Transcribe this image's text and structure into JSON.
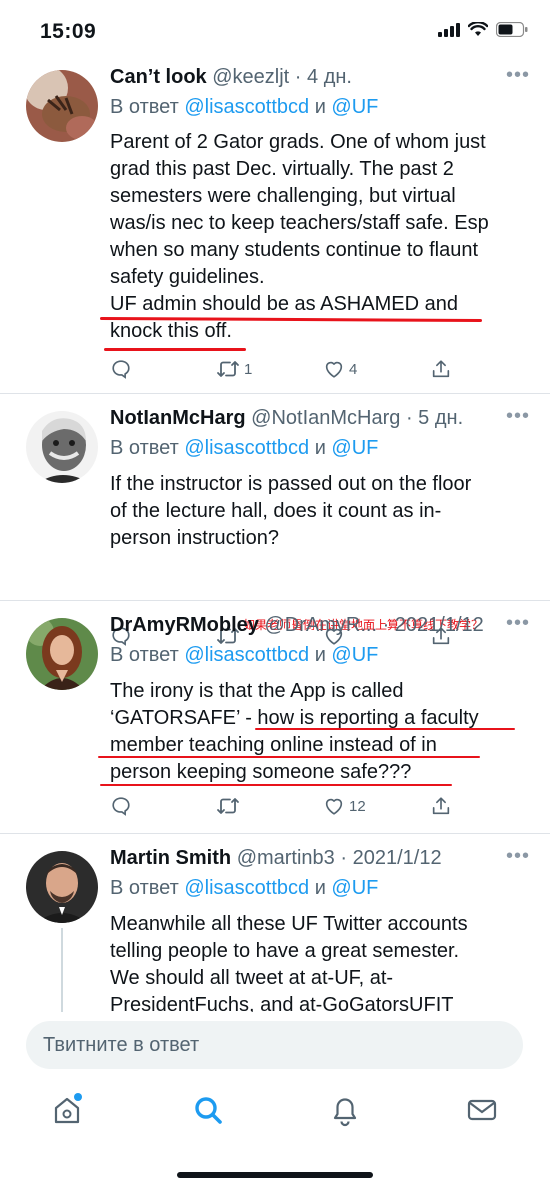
{
  "status_bar": {
    "time": "15:09"
  },
  "tweets": [
    {
      "name": "Can’t look",
      "handle": "@keezljt",
      "time": "· 4 дн.",
      "reply_prefix": "В ответ",
      "reply_user1": "@lisascottbcd",
      "reply_and": "и",
      "reply_user2": "@UF",
      "text_lines": [
        "Parent of 2 Gator grads. One of whom just",
        "grad this past Dec. virtually. The past 2",
        "semesters were challenging, but virtual",
        "was/is nec to keep teachers/staff safe. Esp",
        "when so many students continue to flaunt",
        "safety guidelines.",
        "UF admin should be as ASHAMED and",
        "knock this off."
      ],
      "retweets": "1",
      "likes": "4"
    },
    {
      "name": "NotIanMcHarg",
      "handle": "@NotIanMcHarg",
      "time": "· 5 дн.",
      "reply_prefix": "В ответ",
      "reply_user1": "@lisascottbcd",
      "reply_and": "и",
      "reply_user2": "@UF",
      "text_lines": [
        "If the instructor is passed out on the floor",
        "of the lecture hall, does it count as in-",
        "person instruction?"
      ],
      "annotation": "如果老师昏倒在讲堂地面上算不算线下教学？",
      "retweets": "",
      "likes": ""
    },
    {
      "name": "DrAmyRMobley",
      "handle": "@DrAmyR...",
      "time": "· 2021/1/12",
      "reply_prefix": "В ответ",
      "reply_user1": "@lisascottbcd",
      "reply_and": "и",
      "reply_user2": "@UF",
      "text_lines": [
        "The irony is that the App is called",
        "‘GATORSAFE’ - how is reporting a faculty",
        "member teaching online instead of in",
        "person keeping someone safe???"
      ],
      "retweets": "",
      "likes": "12"
    },
    {
      "name": "Martin Smith",
      "handle": "@martinb3",
      "time": "· 2021/1/12",
      "reply_prefix": "В ответ",
      "reply_user1": "@lisascottbcd",
      "reply_and": "и",
      "reply_user2": "@UF",
      "text_lines": [
        "Meanwhile all these UF Twitter accounts",
        "telling people to have a great semester.",
        "We should all tweet at at-UF, at-",
        "PresidentFuchs, and at-GoGatorsUFIT"
      ]
    }
  ],
  "composer": {
    "placeholder": "Твитните в ответ"
  },
  "tabbar": {
    "items": [
      "home-icon",
      "search-icon",
      "notifications-icon",
      "messages-icon"
    ]
  },
  "colors": {
    "accent": "#1d9bf0",
    "annotation": "#e8131b",
    "text": "#0f1419",
    "muted": "#536471"
  }
}
